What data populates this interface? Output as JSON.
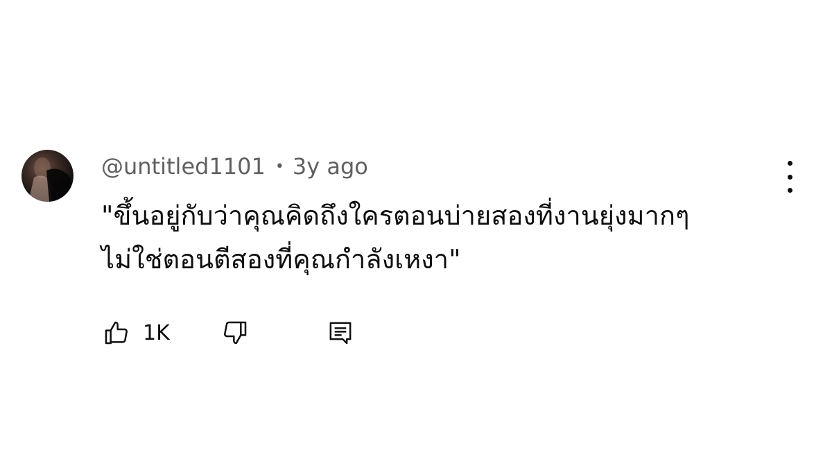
{
  "comment": {
    "author": "@untitled1101",
    "separator": "•",
    "timestamp": "3y ago",
    "text_lines": [
      "\"ขึ้นอยู่กับว่าคุณคิดถึงใครตอนบ่ายสองที่งานยุ่งมากๆ",
      "ไม่ใช่ตอนตีสองที่คุณกำลังเหงา\""
    ],
    "like_count": "1K",
    "icons": {
      "like": "thumbs-up-icon",
      "dislike": "thumbs-down-icon",
      "reply": "reply-comment-icon",
      "more": "more-vertical-icon"
    }
  }
}
